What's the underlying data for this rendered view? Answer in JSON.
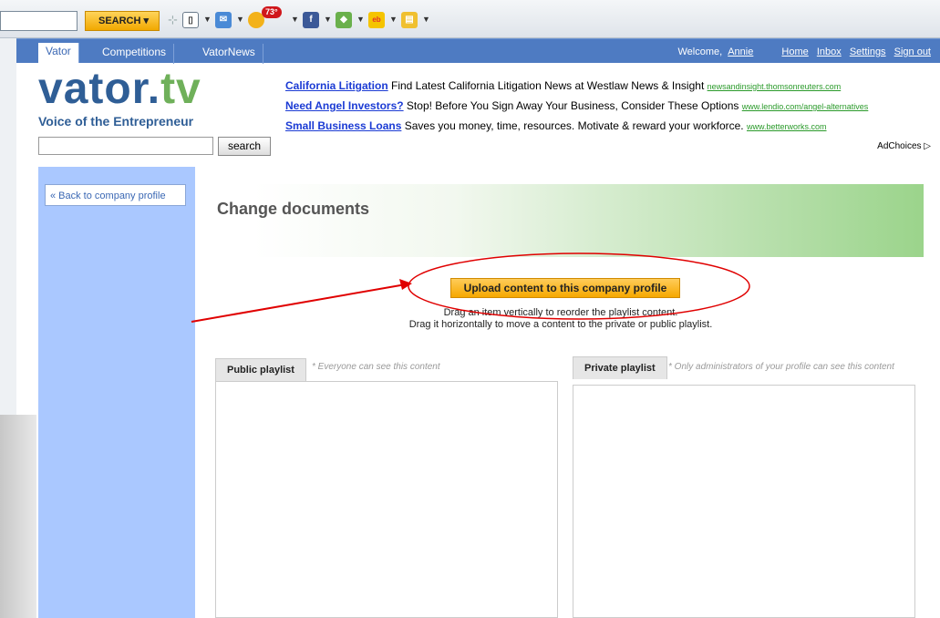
{
  "toolbar": {
    "search_label": "SEARCH ▾",
    "weather_temp": "73°",
    "icons": [
      "page-icon",
      "mail-icon",
      "weather-icon",
      "facebook-icon",
      "game-icon",
      "ebay-icon",
      "bookmark-icon"
    ]
  },
  "nav": {
    "tabs": [
      "Vator",
      "Competitions",
      "VatorNews"
    ],
    "welcome": "Welcome,",
    "user": "Annie",
    "links": [
      "Home",
      "Inbox",
      "Settings",
      "Sign out"
    ]
  },
  "header": {
    "logo_main": "vator.",
    "logo_tv": "tv",
    "tagline": "Voice of the Entrepreneur",
    "search_button": "search"
  },
  "ads": [
    {
      "title": "California Litigation",
      "text": " Find Latest California Litigation News at Westlaw News & Insight ",
      "url": "newsandinsight.thomsonreuters.com"
    },
    {
      "title": "Need Angel Investors?",
      "text": " Stop! Before You Sign Away Your Business, Consider These Options ",
      "url": "www.lendio.com/angel-alternatives"
    },
    {
      "title": "Small Business Loans",
      "text": " Saves you money, time, resources. Motivate & reward your workforce. ",
      "url": "www.betterworks.com"
    }
  ],
  "adchoices": "AdChoices ▷",
  "sidebar": {
    "back_label": "« Back to company profile"
  },
  "main": {
    "title": "Change documents",
    "upload_label": "Upload content to this company profile",
    "hint_1": "Drag an item vertically to reorder the playlist content.",
    "hint_2": "Drag it horizontally to move a content to the private or public playlist.",
    "public_tab": "Public playlist",
    "public_note": "* Everyone can see this content",
    "private_tab": "Private playlist",
    "private_note": "* Only administrators of your profile can see this content"
  },
  "colors": {
    "nav": "#4e7bc2",
    "sidebar": "#aac8ff",
    "upload": "#f6a800",
    "annotation": "#e00000"
  }
}
